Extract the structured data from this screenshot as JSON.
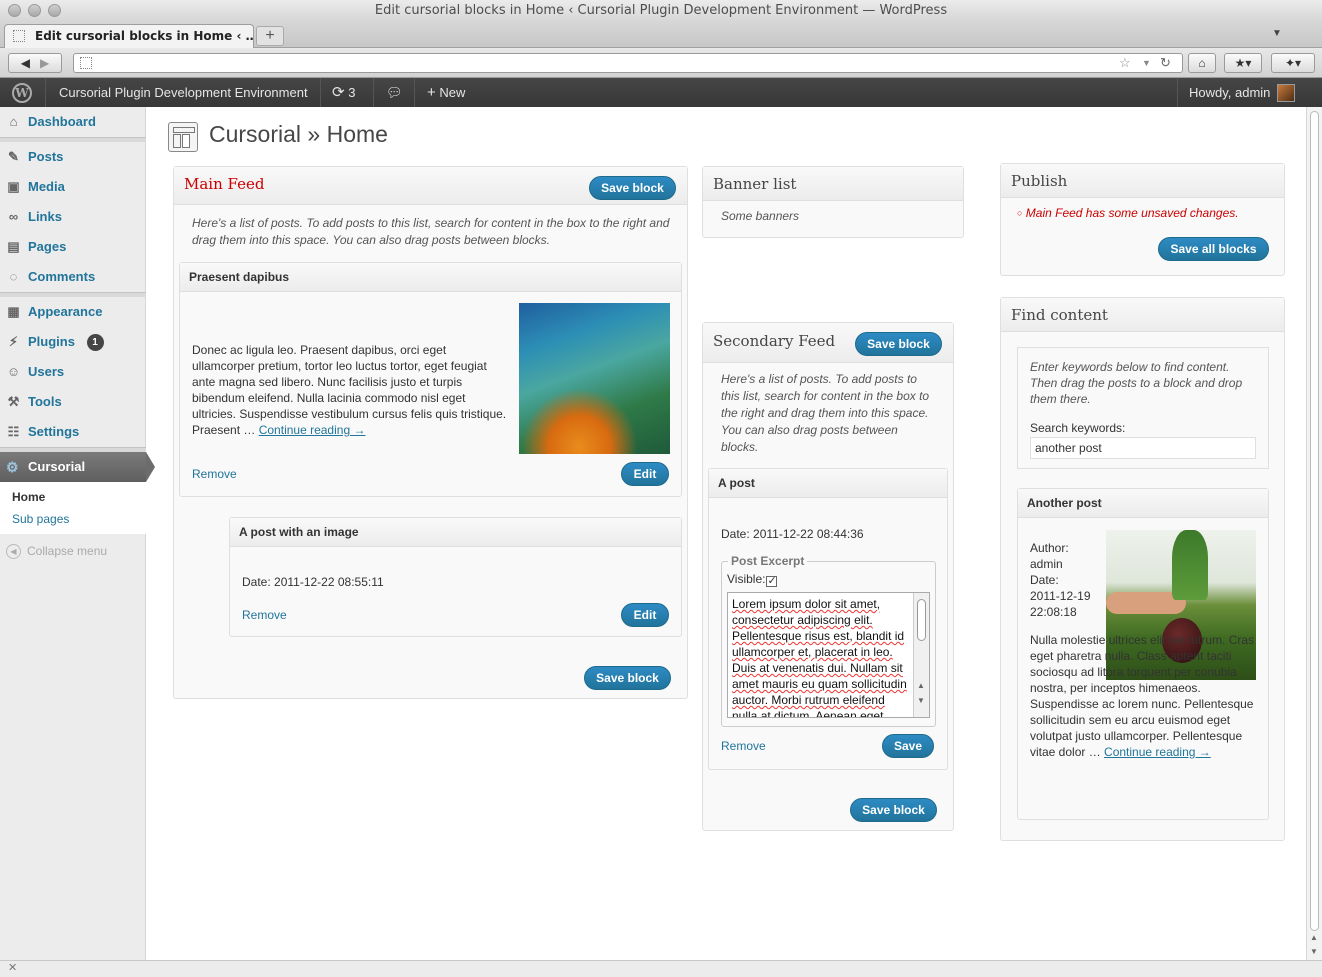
{
  "window": {
    "title": "Edit cursorial blocks in Home ‹ Cursorial Plugin Development Environment — WordPress"
  },
  "browser": {
    "tab_title": "Edit cursorial blocks in Home ‹ …",
    "url": ""
  },
  "adminbar": {
    "site_name": "Cursorial Plugin Development Environment",
    "updates_count": "3",
    "new_label": "New",
    "howdy": "Howdy, admin"
  },
  "sidebar": {
    "items": [
      {
        "label": "Dashboard"
      },
      {
        "label": "Posts"
      },
      {
        "label": "Media"
      },
      {
        "label": "Links"
      },
      {
        "label": "Pages"
      },
      {
        "label": "Comments"
      },
      {
        "label": "Appearance"
      },
      {
        "label": "Plugins",
        "badge": "1"
      },
      {
        "label": "Users"
      },
      {
        "label": "Tools"
      },
      {
        "label": "Settings"
      }
    ],
    "active": "Cursorial",
    "submenu": [
      "Home",
      "Sub pages"
    ],
    "collapse": "Collapse menu"
  },
  "page": {
    "title": "Cursorial » Home"
  },
  "main_feed": {
    "title": "Main Feed",
    "title_color": "#cc0000",
    "save_label": "Save block",
    "description": "Here's a list of posts. To add posts to this list, search for content in the box to the right and drag them into this space. You can also drag posts between blocks.",
    "posts": [
      {
        "title": "Praesent dapibus",
        "excerpt": "Donec ac ligula leo. Praesent dapibus, orci eget ullamcorper pretium, tortor leo luctus tortor, eget feugiat ante magna sed libero. Nunc facilisis justo et turpis bibendum eleifend. Nulla lacinia commodo nisl eget ultricies. Suspendisse vestibulum cursus felis quis tristique. Praesent …",
        "continue": "Continue reading →",
        "remove": "Remove",
        "edit": "Edit"
      },
      {
        "title": "A post with an image",
        "date": "Date: 2011-12-22 08:55:11",
        "remove": "Remove",
        "edit": "Edit"
      }
    ],
    "save_bottom": "Save block"
  },
  "banner_list": {
    "title": "Banner list",
    "description": "Some banners"
  },
  "secondary_feed": {
    "title": "Secondary Feed",
    "save_label": "Save block",
    "description": "Here's a list of posts. To add posts to this list, search for content in the box to the right and drag them into this space. You can also drag posts between blocks.",
    "post": {
      "title": "A post",
      "date": "Date: 2011-12-22 08:44:36",
      "excerpt_legend": "Post Excerpt",
      "visible_label": "Visible:",
      "visible_checked": true,
      "excerpt_text": "Lorem ipsum dolor sit amet, consectetur adipiscing elit. Pellentesque risus est, blandit id ullamcorper et, placerat in leo. Duis at venenatis dui. Nullam sit amet mauris eu quam sollicitudin auctor. Morbi rutrum eleifend nulla at dictum. Aenean eget",
      "remove": "Remove",
      "save": "Save"
    },
    "save_bottom": "Save block"
  },
  "publish": {
    "title": "Publish",
    "message": "Main Feed has some unsaved changes.",
    "message_color": "#cc0000",
    "save_all": "Save all blocks"
  },
  "find_content": {
    "title": "Find content",
    "instructions": "Enter keywords below to find content. Then drag the posts to a block and drop them there.",
    "search_label": "Search keywords:",
    "search_value": "another post",
    "result": {
      "title": "Another post",
      "author_label": "Author:",
      "author": "admin",
      "date_label": "Date:",
      "date": "2011-12-19 22:08:18",
      "excerpt": "Nulla molestie ultrices elit vel rutrum. Cras eget pharetra nulla. Class aptent taciti sociosqu ad litora torquent per conubia nostra, per inceptos himenaeos. Suspendisse ac lorem nunc. Pellentesque sollicitudin sem eu arcu euismod eget volutpat justo ullamcorper. Pellentesque vitae dolor …",
      "continue": "Continue reading →"
    }
  },
  "colors": {
    "accent": "#21759b",
    "adminbar": "#464646",
    "error": "#cc0000"
  }
}
